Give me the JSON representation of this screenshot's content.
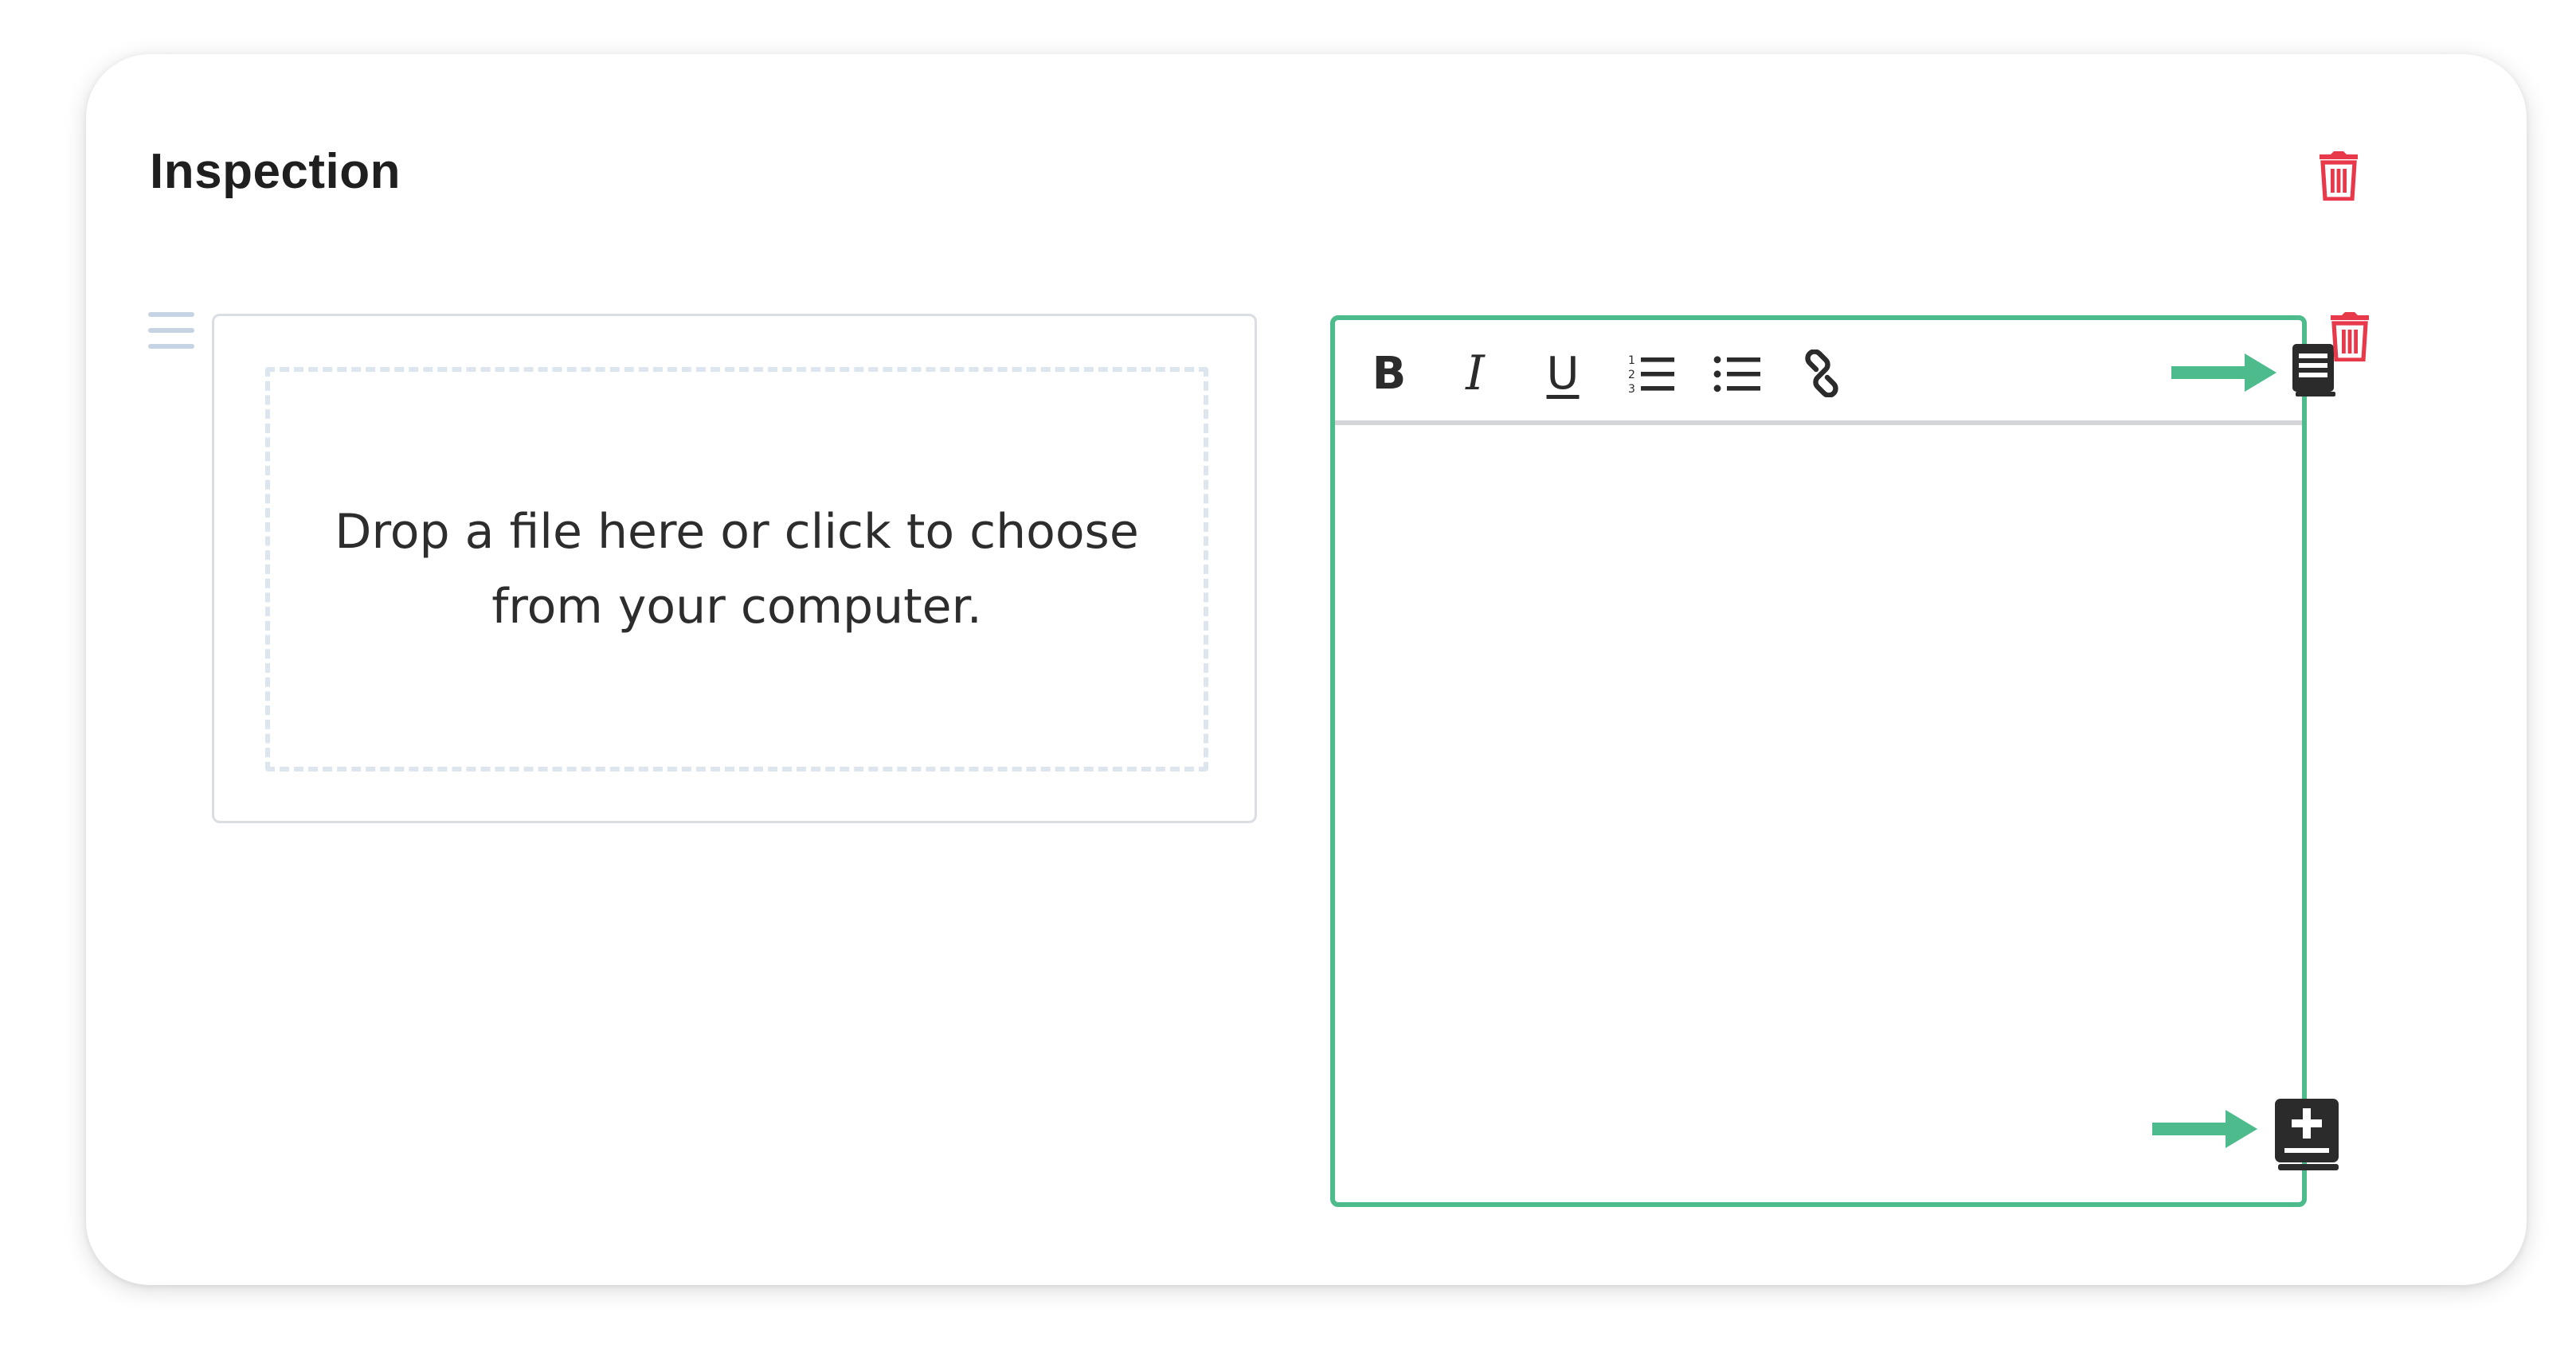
{
  "section": {
    "title": "Inspection",
    "delete_icon": "trash-icon"
  },
  "row": {
    "drag_icon": "drag-handle-icon",
    "delete_icon": "trash-icon"
  },
  "upload": {
    "dropzone_text": "Drop a file here or click to choose from your computer."
  },
  "editor": {
    "toolbar": {
      "bold_label": "B",
      "italic_label": "I",
      "underline_label": "U",
      "ordered_list_icon": "ordered-list-icon",
      "unordered_list_icon": "unordered-list-icon",
      "link_icon": "link-icon",
      "library_icon": "book-icon"
    },
    "content": "",
    "add_to_library_icon": "book-plus-icon"
  },
  "colors": {
    "accent_green": "#4dbb8c",
    "delete_red": "#e8394a",
    "icon_dark": "#2b2b2b",
    "drag_handle": "#c5d3e3"
  }
}
